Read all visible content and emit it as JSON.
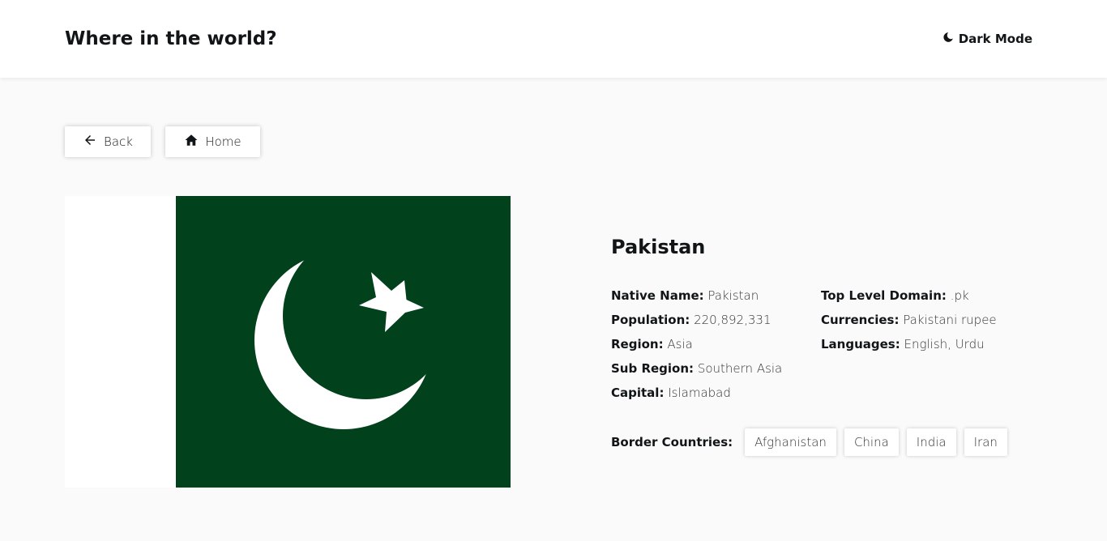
{
  "header": {
    "title": "Where in the world?",
    "dark_mode_label": "Dark Mode",
    "dark_mode_icon": "moon-icon"
  },
  "nav": {
    "back_label": "Back",
    "back_icon": "arrow-left-icon",
    "home_label": "Home",
    "home_icon": "home-icon"
  },
  "flag": {
    "country": "Pakistan",
    "colors": {
      "green": "#01411c",
      "white": "#ffffff"
    }
  },
  "country": {
    "name": "Pakistan",
    "left": [
      {
        "label": "Native Name:",
        "value": "Pakistan"
      },
      {
        "label": "Population:",
        "value": "220,892,331"
      },
      {
        "label": "Region:",
        "value": "Asia"
      },
      {
        "label": "Sub Region:",
        "value": "Southern Asia"
      },
      {
        "label": "Capital:",
        "value": "Islamabad"
      }
    ],
    "right": [
      {
        "label": "Top Level Domain:",
        "value": ".pk"
      },
      {
        "label": "Currencies:",
        "value": "Pakistani rupee"
      },
      {
        "label": "Languages:",
        "value": "English, Urdu"
      }
    ],
    "borders_label": "Border Countries:",
    "borders": [
      "Afghanistan",
      "China",
      "India",
      "Iran"
    ]
  },
  "theme": {
    "page_bg": "#fafafa",
    "card_bg": "#ffffff",
    "text": "#111517"
  }
}
